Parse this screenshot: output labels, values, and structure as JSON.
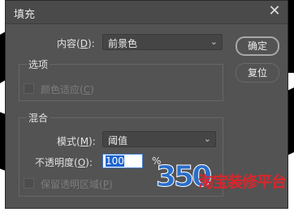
{
  "window": {
    "title": "填充",
    "close_glyph": "✕"
  },
  "buttons": {
    "ok": "确定",
    "reset": "复位"
  },
  "contents": {
    "label": "内容(D):",
    "value": "前景色"
  },
  "options_group": {
    "title": "选项",
    "color_adaptation": {
      "label": "颜色适应(C)",
      "checked": false,
      "enabled": false
    }
  },
  "blending_group": {
    "title": "混合",
    "mode": {
      "label": "模式(M):",
      "value": "阈值"
    },
    "opacity": {
      "label": "不透明度(O):",
      "value": "100",
      "unit": "%"
    },
    "preserve_transparency": {
      "label": "保留透明区域(P)",
      "checked": false,
      "enabled": false
    }
  },
  "watermark": {
    "digits": "350",
    "text": "淘宝装修平台"
  },
  "colors": {
    "dialog": "#535353",
    "accent": "#1e64d0",
    "watermark_blue": "#2a6dc9",
    "watermark_red": "#d9262c"
  }
}
